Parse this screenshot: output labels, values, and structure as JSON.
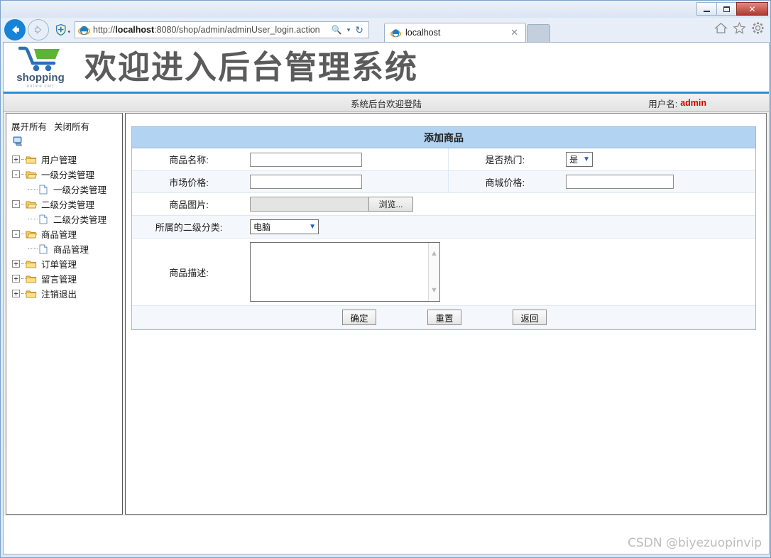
{
  "browser": {
    "window_controls": {
      "minimize": "minimize-icon",
      "maximize": "maximize-icon",
      "close": "✕"
    },
    "back_icon": "back-arrow-icon",
    "forward_icon": "forward-arrow-icon",
    "shield_icon": "tracking-protection-icon",
    "url_prefix": "http://",
    "url_host": "localhost",
    "url_rest": ":8080/shop/admin/adminUser_login.action",
    "url_full": "http://localhost:8080/shop/admin/adminUser_login.action",
    "search_icon": "search-icon",
    "refresh_icon": "refresh-icon",
    "tab_label": "localhost",
    "tab_close": "✕",
    "new_tab_label": "",
    "home_icon": "home-icon",
    "favorites_icon": "star-icon",
    "settings_icon": "gear-icon"
  },
  "header": {
    "logo_word": "shopping",
    "logo_sub": "online cart",
    "title": "欢迎进入后台管理系统"
  },
  "statusbar": {
    "center_text": "系统后台欢迎登陆",
    "user_label": "用户名:",
    "user_name": "admin"
  },
  "sidebar": {
    "expand_all": "展开所有",
    "collapse_all": "关闭所有",
    "root_icon": "computer-icon",
    "nodes": [
      {
        "label": "用户管理",
        "state": "+",
        "type": "folder",
        "level": 0
      },
      {
        "label": "一级分类管理",
        "state": "-",
        "type": "folder-open",
        "level": 0
      },
      {
        "label": "一级分类管理",
        "state": "",
        "type": "doc",
        "level": 1
      },
      {
        "label": "二级分类管理",
        "state": "-",
        "type": "folder-open",
        "level": 0
      },
      {
        "label": "二级分类管理",
        "state": "",
        "type": "doc",
        "level": 1
      },
      {
        "label": "商品管理",
        "state": "-",
        "type": "folder-open",
        "level": 0
      },
      {
        "label": "商品管理",
        "state": "",
        "type": "doc",
        "level": 1
      },
      {
        "label": "订单管理",
        "state": "+",
        "type": "folder",
        "level": 0
      },
      {
        "label": "留言管理",
        "state": "+",
        "type": "folder",
        "level": 0
      },
      {
        "label": "注销退出",
        "state": "+",
        "type": "folder",
        "level": 0
      }
    ]
  },
  "form": {
    "title": "添加商品",
    "fields": {
      "name_label": "商品名称:",
      "name_value": "",
      "hot_label": "是否热门:",
      "hot_value": "是",
      "market_price_label": "市场价格:",
      "market_price_value": "",
      "shop_price_label": "商城价格:",
      "shop_price_value": "",
      "image_label": "商品图片:",
      "image_value": "",
      "browse_button": "浏览...",
      "category_label": "所属的二级分类:",
      "category_value": "电脑",
      "description_label": "商品描述:",
      "description_value": ""
    },
    "buttons": {
      "submit": "确定",
      "reset": "重置",
      "back": "返回"
    }
  },
  "watermark": "CSDN @biyezuopinvip",
  "colors": {
    "panel_title_bg": "#b2d3f2",
    "accent_blue": "#2a8fd4",
    "user_name_red": "#d60000",
    "row_alt_bg": "#f4f8fd"
  }
}
